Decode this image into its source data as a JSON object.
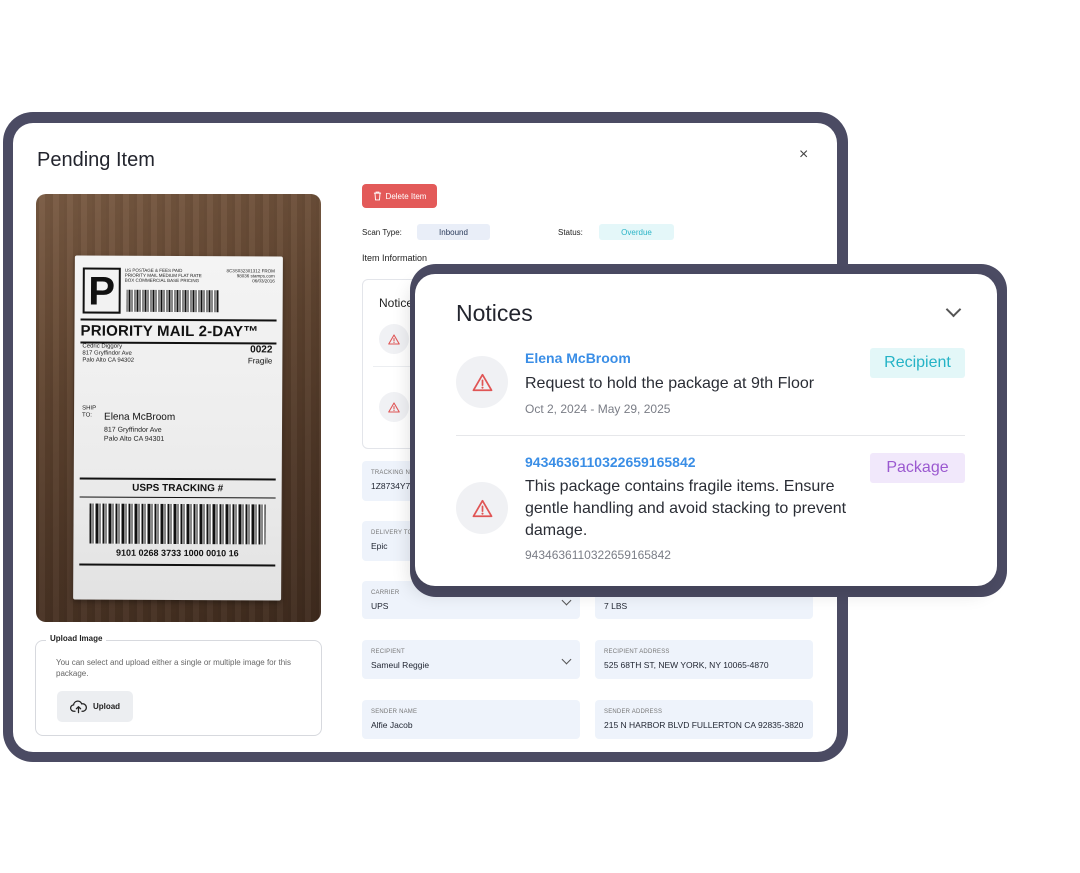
{
  "modal": {
    "title": "Pending Item",
    "close_icon": "×",
    "delete_label": "Delete Item",
    "scan_type_label": "Scan Type:",
    "scan_type_value": "Inbound",
    "status_label": "Status:",
    "status_value": "Overdue",
    "section_title": "Item Information",
    "notices_mini_title": "Notices"
  },
  "label_photo": {
    "mail_class_letter": "P",
    "header_left": "US POSTAGE & FEES PAID PRIORITY MAIL MEDIUM FLAT RATE BOX COMMERCIAL BASE PRICING",
    "header_right": "8C3S032301312 FROM 98036 stamps.com 06/03/2016",
    "service": "PRIORITY MAIL 2-DAY™",
    "from_name": "Cedric Diggory",
    "from_line1": "817 Gryffindor Ave",
    "from_line2": "Palo Alto CA 94302",
    "code": "0022",
    "code_note": "Fragile",
    "ship_to_label": "SHIP TO:",
    "to_name": "Elena McBroom",
    "to_line1": "817 Gryffindor Ave",
    "to_line2": "Palo Alto CA 94301",
    "tracking_title": "USPS TRACKING #",
    "tracking_number": "9101 0268 3733 1000 0010 16"
  },
  "upload": {
    "legend": "Upload Image",
    "description": "You can select and upload either a single or multiple image for this package.",
    "button_label": "Upload"
  },
  "fields": {
    "tracking": {
      "label": "TRACKING NUM",
      "value": "1Z8734Y70"
    },
    "delivery": {
      "label": "DELIVERY TO",
      "value": "Epic"
    },
    "carrier": {
      "label": "CARRIER",
      "value": "UPS"
    },
    "weight": {
      "label": "",
      "value": "7 LBS"
    },
    "recipient": {
      "label": "RECIPIENT",
      "value": "Sameul Reggie"
    },
    "recipient_address": {
      "label": "RECIPIENT ADDRESS",
      "value": "525 68TH ST, NEW YORK, NY 10065-4870"
    },
    "sender_name": {
      "label": "SENDER NAME",
      "value": "Alfie Jacob"
    },
    "sender_address": {
      "label": "SENDER ADDRESS",
      "value": "215 N HARBOR BLVD FULLERTON CA 92835-3820"
    }
  },
  "notices": {
    "title": "Notices",
    "items": [
      {
        "heading": "Elena McBroom",
        "body": "Request to hold the package at 9th Floor",
        "sub": "Oct 2, 2024 - May 29, 2025",
        "tag": "Recipient"
      },
      {
        "heading": "9434636110322659165842",
        "body": "This package contains fragile items. Ensure gentle handling and avoid stacking to prevent damage.",
        "sub": "9434636110322659165842",
        "tag": "Package"
      }
    ]
  },
  "colors": {
    "frame": "#4b4b63",
    "link_blue": "#3a8ee6",
    "danger": "#e35a59",
    "recipient_tag_bg": "#e3f7f8",
    "recipient_tag_fg": "#25b3c6",
    "package_tag_bg": "#f1e8fb",
    "package_tag_fg": "#9b59d0"
  },
  "icons": {
    "close": "close-icon",
    "delete": "trash-icon",
    "upload": "cloud-upload-icon",
    "alert": "alert-triangle-icon",
    "chevron": "chevron-down-icon"
  }
}
